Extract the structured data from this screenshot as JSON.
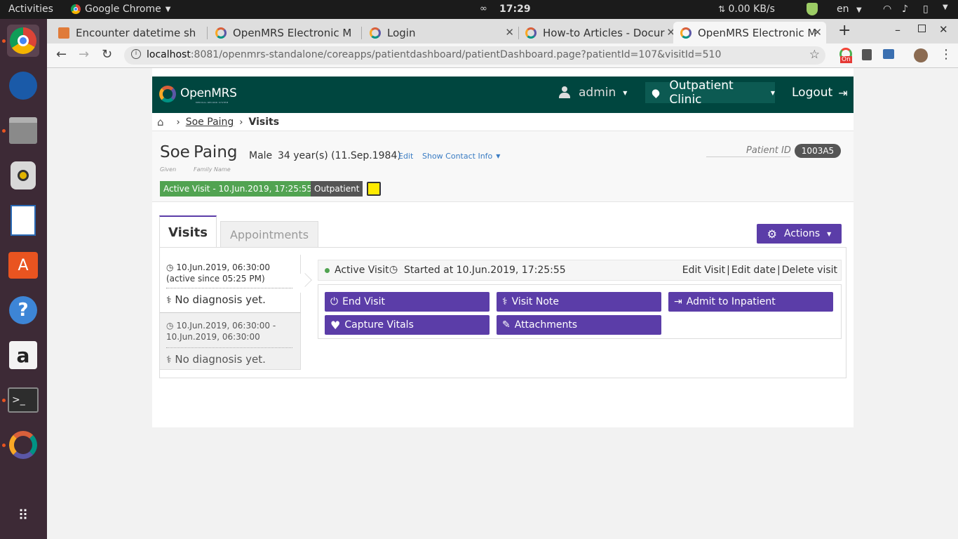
{
  "os": {
    "activities": "Activities",
    "app_name": "Google Chrome",
    "clock": "17:29",
    "net_speed": "0.00 KB/s",
    "language": "en"
  },
  "browser": {
    "tabs": [
      {
        "label": "Encounter datetime sh"
      },
      {
        "label": "OpenMRS Electronic M"
      },
      {
        "label": "Login"
      },
      {
        "label": "How-to Articles - Docur"
      },
      {
        "label": "OpenMRS Electronic M"
      }
    ],
    "url_host": "localhost",
    "url_rest": ":8081/openmrs-standalone/coreapps/patientdashboard/patientDashboard.page?patientId=107&visitId=510",
    "ext_badge": "On"
  },
  "header": {
    "logo": "OpenMRS",
    "logo_sub": "MEDICAL RECORD SYSTEM",
    "user": "admin",
    "location": "Outpatient Clinic",
    "logout": "Logout"
  },
  "breadcrumb": {
    "patient": "Soe Paing",
    "current": "Visits"
  },
  "patient": {
    "given": "Soe",
    "family": "Paing",
    "given_label": "Given",
    "family_label": "Family Name",
    "gender": "Male",
    "age": "34 year(s) (11.Sep.1984)",
    "edit": "Edit",
    "contact": "Show Contact Info",
    "id_label": "Patient ID",
    "id_value": "1003A5",
    "active_visit": "Active Visit - 10.Jun.2019, 17:25:55",
    "visit_type": "Outpatient"
  },
  "tabs": {
    "visits": "Visits",
    "appointments": "Appointments",
    "actions": "Actions"
  },
  "visit_list": [
    {
      "when": "10.Jun.2019, 06:30:00 (active since 05:25 PM)",
      "diagnosis": "No diagnosis yet."
    },
    {
      "when": "10.Jun.2019, 06:30:00 - 10.Jun.2019, 06:30:00",
      "diagnosis": "No diagnosis yet."
    }
  ],
  "visit_detail": {
    "status": "Active Visit",
    "started": "Started at 10.Jun.2019, 17:25:55",
    "edit_visit": "Edit Visit",
    "edit_date": "Edit date",
    "delete_visit": "Delete visit",
    "sep": "|",
    "buttons": {
      "end_visit": "End Visit",
      "visit_note": "Visit Note",
      "admit": "Admit to Inpatient",
      "capture_vitals": "Capture Vitals",
      "attachments": "Attachments"
    }
  },
  "colors": {
    "header": "#00463f",
    "accent": "#5b3da8",
    "active_visit": "#51a351"
  }
}
